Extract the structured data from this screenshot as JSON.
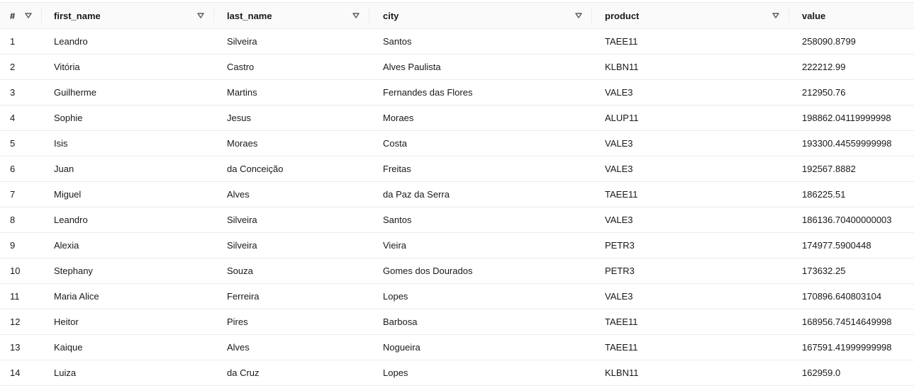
{
  "columns": [
    {
      "key": "index",
      "label": "#"
    },
    {
      "key": "first_name",
      "label": "first_name"
    },
    {
      "key": "last_name",
      "label": "last_name"
    },
    {
      "key": "city",
      "label": "city"
    },
    {
      "key": "product",
      "label": "product"
    },
    {
      "key": "value",
      "label": "value"
    }
  ],
  "rows": [
    {
      "index": "1",
      "first_name": "Leandro",
      "last_name": "Silveira",
      "city": "Santos",
      "product": "TAEE11",
      "value": "258090.8799"
    },
    {
      "index": "2",
      "first_name": "Vitória",
      "last_name": "Castro",
      "city": "Alves Paulista",
      "product": "KLBN11",
      "value": "222212.99"
    },
    {
      "index": "3",
      "first_name": "Guilherme",
      "last_name": "Martins",
      "city": "Fernandes das Flores",
      "product": "VALE3",
      "value": "212950.76"
    },
    {
      "index": "4",
      "first_name": "Sophie",
      "last_name": "Jesus",
      "city": "Moraes",
      "product": "ALUP11",
      "value": "198862.04119999998"
    },
    {
      "index": "5",
      "first_name": "Isis",
      "last_name": "Moraes",
      "city": "Costa",
      "product": "VALE3",
      "value": "193300.44559999998"
    },
    {
      "index": "6",
      "first_name": "Juan",
      "last_name": "da Conceição",
      "city": "Freitas",
      "product": "VALE3",
      "value": "192567.8882"
    },
    {
      "index": "7",
      "first_name": "Miguel",
      "last_name": "Alves",
      "city": "da Paz da Serra",
      "product": "TAEE11",
      "value": "186225.51"
    },
    {
      "index": "8",
      "first_name": "Leandro",
      "last_name": "Silveira",
      "city": "Santos",
      "product": "VALE3",
      "value": "186136.70400000003"
    },
    {
      "index": "9",
      "first_name": "Alexia",
      "last_name": "Silveira",
      "city": "Vieira",
      "product": "PETR3",
      "value": "174977.5900448"
    },
    {
      "index": "10",
      "first_name": "Stephany",
      "last_name": "Souza",
      "city": "Gomes dos Dourados",
      "product": "PETR3",
      "value": "173632.25"
    },
    {
      "index": "11",
      "first_name": "Maria Alice",
      "last_name": "Ferreira",
      "city": "Lopes",
      "product": "VALE3",
      "value": "170896.640803104"
    },
    {
      "index": "12",
      "first_name": "Heitor",
      "last_name": "Pires",
      "city": "Barbosa",
      "product": "TAEE11",
      "value": "168956.74514649998"
    },
    {
      "index": "13",
      "first_name": "Kaique",
      "last_name": "Alves",
      "city": "Nogueira",
      "product": "TAEE11",
      "value": "167591.41999999998"
    },
    {
      "index": "14",
      "first_name": "Luiza",
      "last_name": "da Cruz",
      "city": "Lopes",
      "product": "KLBN11",
      "value": "162959.0"
    }
  ],
  "icons": {
    "sort": "sort-caret-down-icon"
  },
  "colors": {
    "header_bg": "#fafafa",
    "border": "#eaeded",
    "text": "#16191f",
    "icon": "#545b64"
  }
}
